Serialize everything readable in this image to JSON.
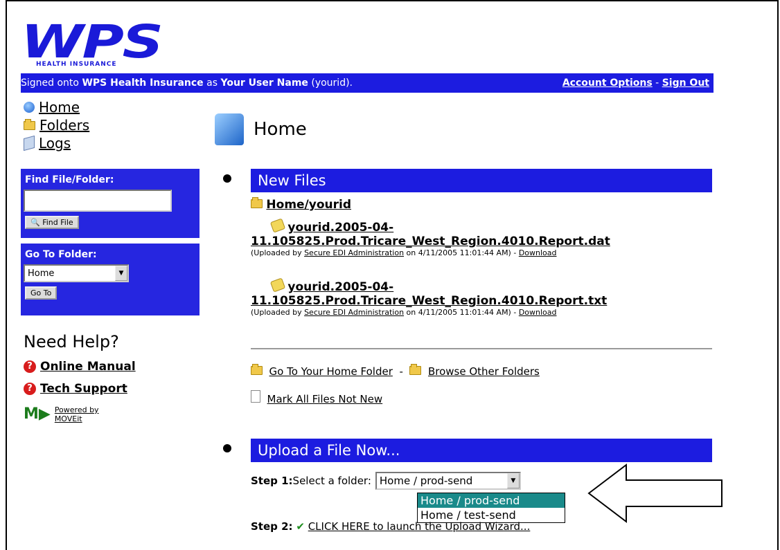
{
  "logo": {
    "text": "WPS",
    "subtitle": "HEALTH INSURANCE"
  },
  "topbar": {
    "prefix": "Signed onto ",
    "company": "WPS Health Insurance",
    "mid": " as ",
    "user": "Your User Name",
    "userid": " (yourid).",
    "account_options": "Account Options",
    "dash": " - ",
    "sign_out": "Sign Out"
  },
  "nav": {
    "home": "Home",
    "folders": "Folders",
    "logs": "Logs"
  },
  "find": {
    "label": "Find File/Folder:",
    "value": "",
    "button": "Find File"
  },
  "goto": {
    "label": "Go To Folder:",
    "selected": "Home",
    "button": "Go To"
  },
  "help": {
    "title": "Need Help?",
    "manual": "Online Manual",
    "support": "Tech Support"
  },
  "powered": {
    "line1": "Powered by",
    "line2": "MOVEit"
  },
  "main": {
    "title": "Home",
    "new_files": {
      "header": "New Files",
      "folder": "Home/yourid",
      "files": [
        {
          "name1": "yourid.2005-04-",
          "name2": "11.105825.Prod.Tricare_West_Region.4010.Report.dat",
          "pre": "(Uploaded by ",
          "by": "Secure EDI Administration",
          "when": " on 4/11/2005 11:01:44 AM) - ",
          "download": "Download"
        },
        {
          "name1": "yourid.2005-04-",
          "name2": "11.105825.Prod.Tricare_West_Region.4010.Report.txt",
          "pre": "(Uploaded by ",
          "by": "Secure EDI Administration",
          "when": " on 4/11/2005 11:01:44 AM) - ",
          "download": "Download"
        }
      ],
      "go_home": "Go To Your Home Folder",
      "dash": "-",
      "browse": "Browse Other Folders",
      "mark": "Mark All Files Not New"
    },
    "upload": {
      "header": "Upload a File Now...",
      "step1_label": "Step 1:",
      "step1_text": " Select a folder:",
      "selected": "Home / prod-send",
      "options": [
        "Home / prod-send",
        "Home / test-send"
      ],
      "step2_label": "Step 2:",
      "step2_text": "CLICK HERE to launch the Upload Wizard..."
    }
  }
}
